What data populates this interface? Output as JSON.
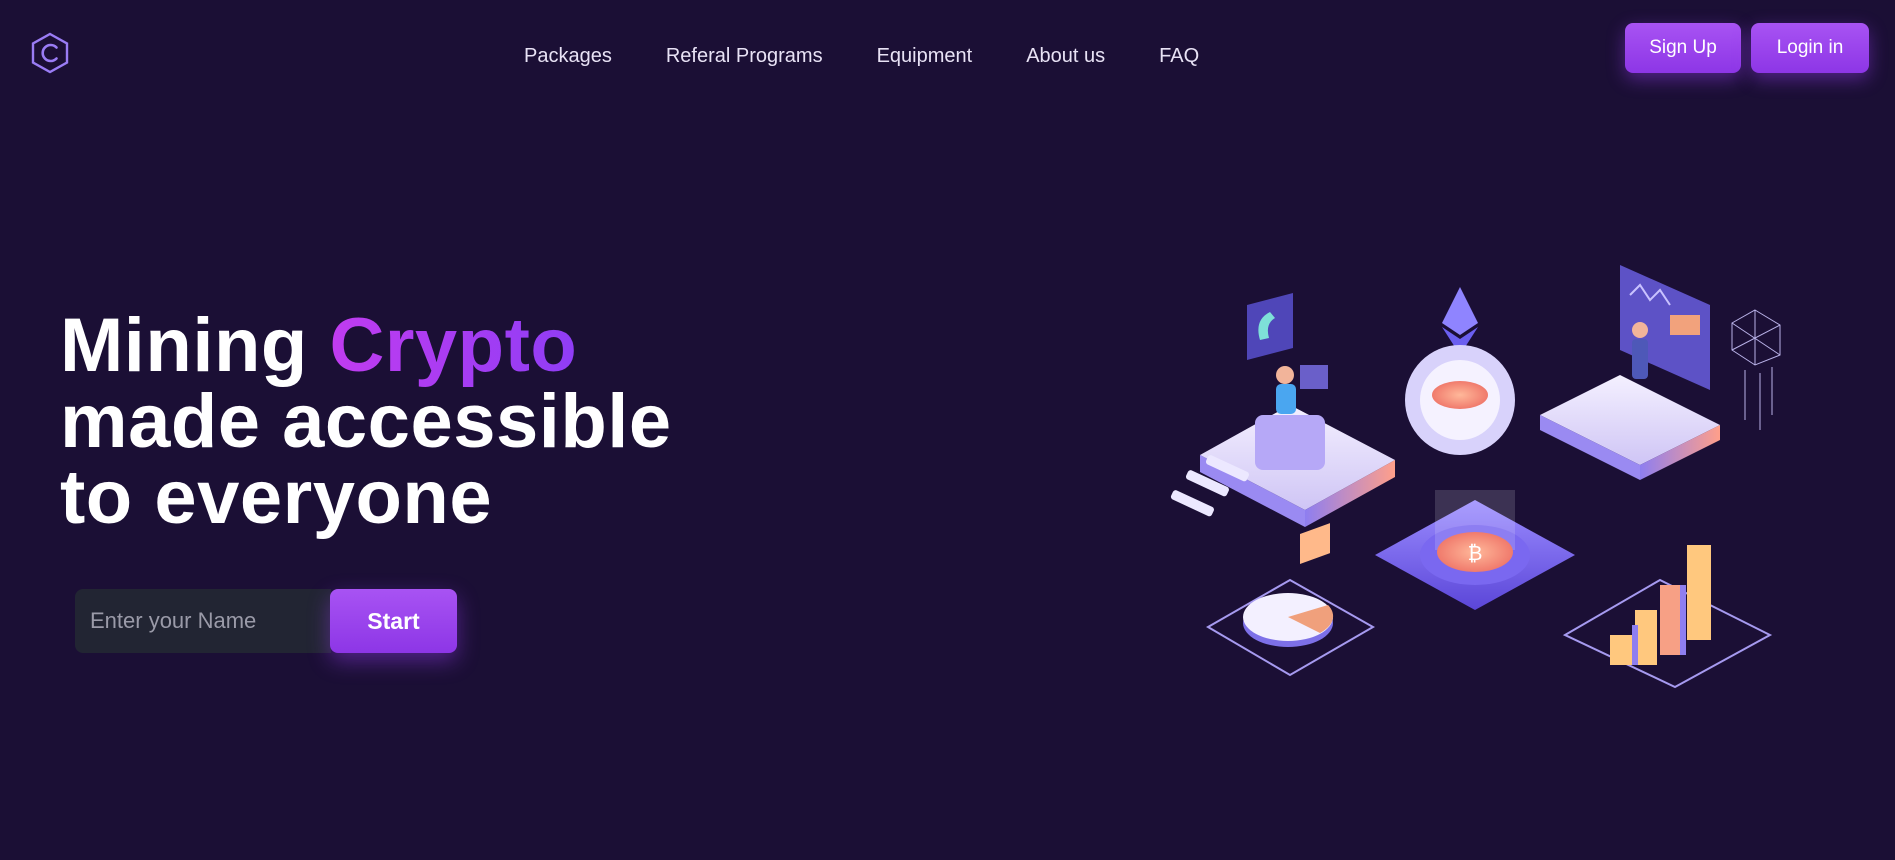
{
  "brand": {
    "logo_icon": "hexagon-c-logo-icon",
    "color": "#9a7cf5"
  },
  "nav": {
    "items": [
      {
        "label": "Packages"
      },
      {
        "label": "Referal Programs"
      },
      {
        "label": "Equipment"
      },
      {
        "label": "About us"
      },
      {
        "label": "FAQ"
      }
    ]
  },
  "auth": {
    "signup_label": "Sign Up",
    "login_label": "Login in"
  },
  "hero": {
    "title_part1": "Mining ",
    "title_accent": "Crypto",
    "title_line2": "made accessible",
    "title_line3": "to everyone",
    "name_placeholder": "Enter your Name",
    "start_label": "Start"
  },
  "illustration": {
    "icons": [
      "ethereum-icon",
      "bitcoin-coin-icon",
      "phone-icon",
      "pie-chart-icon",
      "bar-chart-icon",
      "gear-icon",
      "dashboard-screen-icon",
      "network-globe-icon"
    ]
  },
  "colors": {
    "background": "#1b0f35",
    "accent": "#9b45f0",
    "input_bg": "#222533"
  }
}
